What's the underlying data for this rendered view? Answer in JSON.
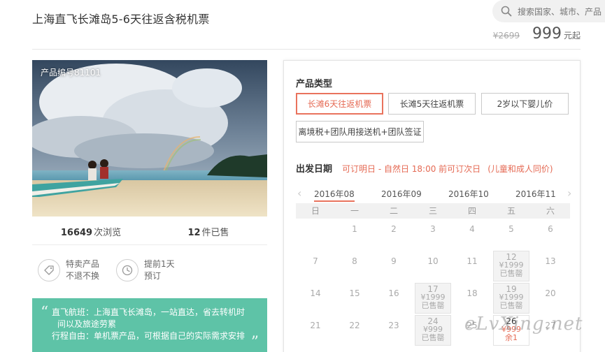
{
  "page": {
    "title": "上海直飞长滩岛5-6天往返含税机票"
  },
  "search": {
    "placeholder": "搜索国家、城市、产品",
    "icon": "search-icon"
  },
  "price": {
    "original": "¥2699",
    "current": "999",
    "unit": "元起"
  },
  "photo": {
    "label": "产品编号81101"
  },
  "stats": {
    "views_count": "16649",
    "views_label": "次浏览",
    "sold_count": "12",
    "sold_label": "件已售"
  },
  "features": [
    {
      "icon": "tag-icon",
      "line1": "特卖产品",
      "line2": "不退不换"
    },
    {
      "icon": "clock-icon",
      "line1": "提前1天",
      "line2": "预订"
    }
  ],
  "note": {
    "line1": "直飞航班：上海直飞长滩岛，一站直达，省去转机时",
    "line2": "间以及旅途劳累",
    "line3": "行程自由：单机票产品，可根据自己的实际需求安排"
  },
  "product_type": {
    "title": "产品类型",
    "options": [
      {
        "label": "长滩6天往返机票",
        "selected": true
      },
      {
        "label": "长滩5天往返机票",
        "selected": false
      },
      {
        "label": "2岁以下婴儿价",
        "selected": false
      },
      {
        "label": "离境税+团队用接送机+团队签证",
        "selected": false
      }
    ]
  },
  "departure": {
    "label": "出发日期",
    "hint": "可订明日 - 自然日 18:00 前可订次日",
    "hint2": "(儿童和成人同价)"
  },
  "calendar": {
    "months": [
      "2016年08",
      "2016年09",
      "2016年10",
      "2016年11"
    ],
    "selected_month": 0,
    "weekdays": [
      "日",
      "一",
      "二",
      "三",
      "四",
      "五",
      "六"
    ],
    "days": [
      {
        "d": "1",
        "col": 1,
        "row": 0
      },
      {
        "d": "2",
        "col": 2,
        "row": 0
      },
      {
        "d": "3",
        "col": 3,
        "row": 0
      },
      {
        "d": "4",
        "col": 4,
        "row": 0
      },
      {
        "d": "5",
        "col": 5,
        "row": 0
      },
      {
        "d": "6",
        "col": 6,
        "row": 0
      },
      {
        "d": "7",
        "col": 0,
        "row": 1
      },
      {
        "d": "8",
        "col": 1,
        "row": 1
      },
      {
        "d": "9",
        "col": 2,
        "row": 1
      },
      {
        "d": "10",
        "col": 3,
        "row": 1
      },
      {
        "d": "11",
        "col": 4,
        "row": 1
      },
      {
        "d": "12",
        "col": 5,
        "row": 1,
        "price": "¥1999",
        "status": "已售罄",
        "kind": "soldout"
      },
      {
        "d": "13",
        "col": 6,
        "row": 1
      },
      {
        "d": "14",
        "col": 0,
        "row": 2
      },
      {
        "d": "15",
        "col": 1,
        "row": 2
      },
      {
        "d": "16",
        "col": 2,
        "row": 2
      },
      {
        "d": "17",
        "col": 3,
        "row": 2,
        "price": "¥1999",
        "status": "已售罄",
        "kind": "soldout"
      },
      {
        "d": "18",
        "col": 4,
        "row": 2
      },
      {
        "d": "19",
        "col": 5,
        "row": 2,
        "price": "¥1999",
        "status": "已售罄",
        "kind": "soldout"
      },
      {
        "d": "20",
        "col": 6,
        "row": 2
      },
      {
        "d": "21",
        "col": 0,
        "row": 3
      },
      {
        "d": "22",
        "col": 1,
        "row": 3
      },
      {
        "d": "23",
        "col": 2,
        "row": 3
      },
      {
        "d": "24",
        "col": 3,
        "row": 3,
        "price": "¥999",
        "status": "已售罄",
        "kind": "soldout"
      },
      {
        "d": "25",
        "col": 4,
        "row": 3
      },
      {
        "d": "26",
        "col": 5,
        "row": 3,
        "price": "¥999",
        "status": "余1",
        "kind": "active"
      },
      {
        "d": "27",
        "col": 6,
        "row": 3
      }
    ]
  },
  "watermark": "eLvXing.net",
  "colors": {
    "accent": "#e9735d",
    "note_bg": "#5ec3a7",
    "soldout_bg": "#f3f3f3"
  }
}
